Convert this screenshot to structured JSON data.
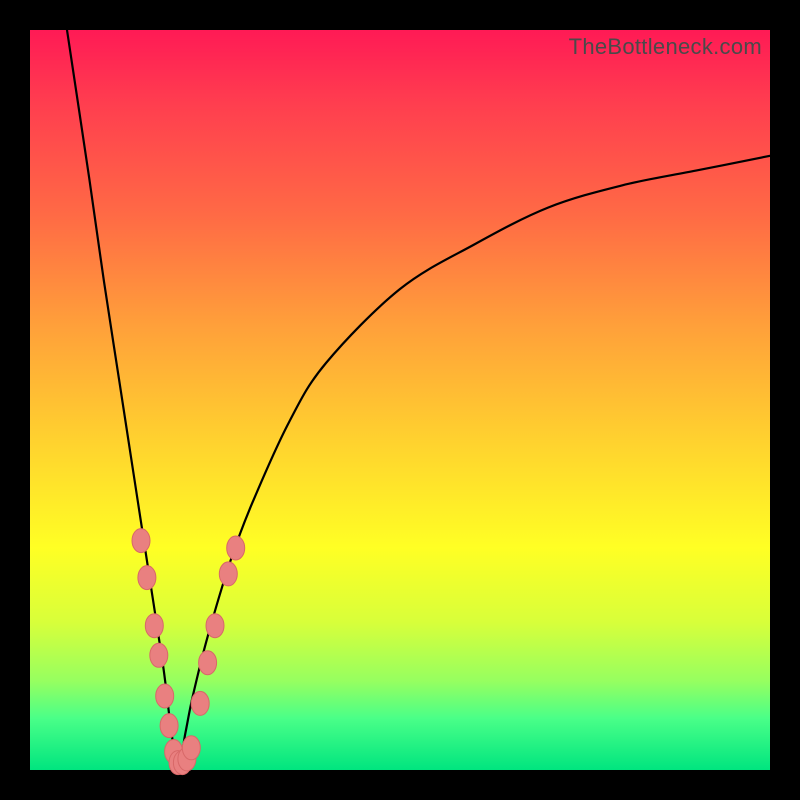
{
  "watermark": "TheBottleneck.com",
  "colors": {
    "curve_stroke": "#000000",
    "marker_fill": "#e98080",
    "marker_stroke": "#d86868",
    "frame_bg": "#000000"
  },
  "chart_data": {
    "type": "line",
    "title": "",
    "xlabel": "",
    "ylabel": "",
    "xlim": [
      0,
      100
    ],
    "ylim": [
      0,
      100
    ],
    "grid": false,
    "curve_note": "V-shaped bottleneck curve; minimum ≈ (20, 0); left branch steep to (5,100); right branch asymptotes toward (100, ~83).",
    "curve": {
      "x": [
        5,
        8,
        10,
        12,
        14,
        16,
        18,
        19,
        20,
        21,
        22,
        24,
        27,
        30,
        35,
        40,
        50,
        60,
        70,
        80,
        90,
        100
      ],
      "y": [
        100,
        80,
        66,
        53,
        40,
        27,
        14,
        6,
        0,
        5,
        10,
        18,
        28,
        36,
        47,
        55,
        65,
        71,
        76,
        79,
        81,
        83
      ]
    },
    "markers_note": "Highlighted points clustered near the minimum of the V.",
    "markers": [
      {
        "x": 15.0,
        "y": 31.0
      },
      {
        "x": 15.8,
        "y": 26.0
      },
      {
        "x": 16.8,
        "y": 19.5
      },
      {
        "x": 17.4,
        "y": 15.5
      },
      {
        "x": 18.2,
        "y": 10.0
      },
      {
        "x": 18.8,
        "y": 6.0
      },
      {
        "x": 19.4,
        "y": 2.5
      },
      {
        "x": 20.0,
        "y": 1.0
      },
      {
        "x": 20.6,
        "y": 1.0
      },
      {
        "x": 21.2,
        "y": 1.5
      },
      {
        "x": 21.8,
        "y": 3.0
      },
      {
        "x": 23.0,
        "y": 9.0
      },
      {
        "x": 24.0,
        "y": 14.5
      },
      {
        "x": 25.0,
        "y": 19.5
      },
      {
        "x": 26.8,
        "y": 26.5
      },
      {
        "x": 27.8,
        "y": 30.0
      }
    ]
  }
}
